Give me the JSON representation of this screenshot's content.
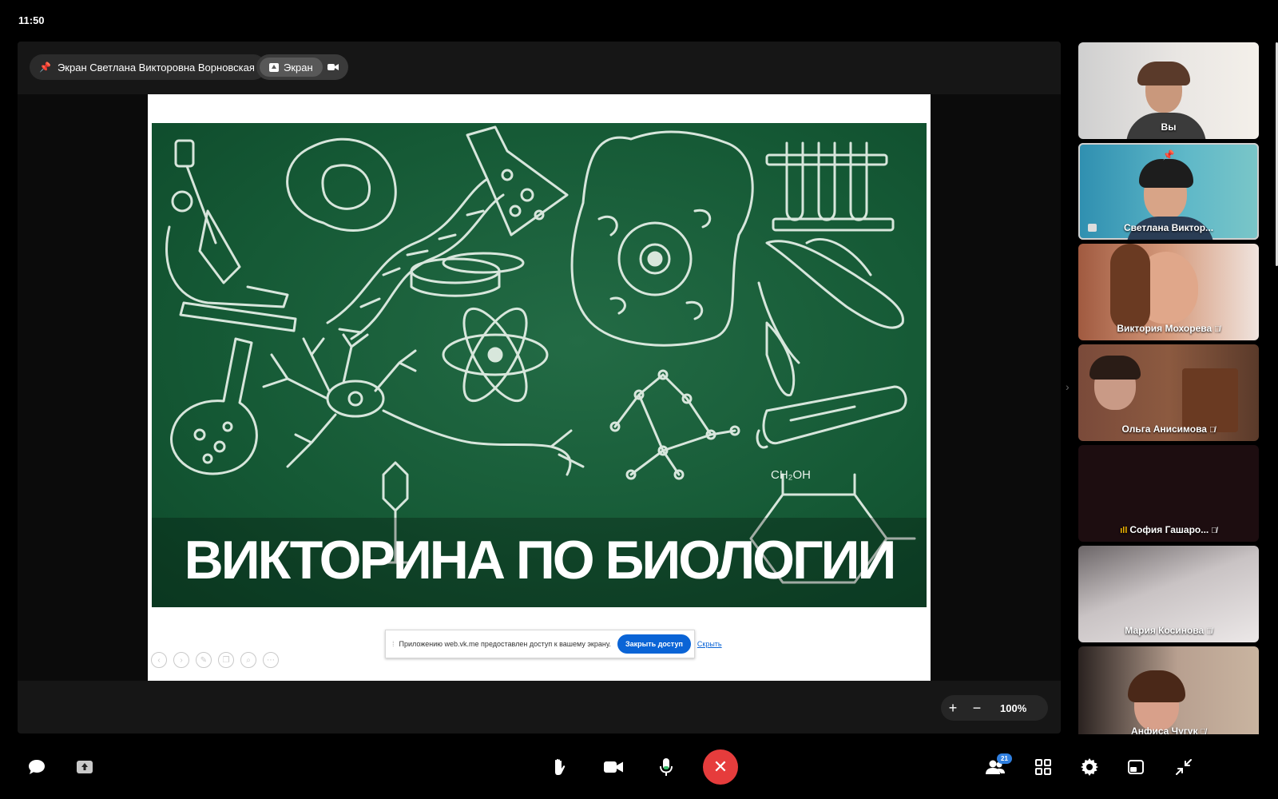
{
  "clock": "11:50",
  "stage": {
    "pinned_label": "Экран Светлана Викторовна Ворновская",
    "screen_label": "Экран",
    "zoom_value": "100%"
  },
  "slide": {
    "title": "ВИКТОРИНА ПО БИОЛОГИИ",
    "chem_label": "CH₂OH",
    "notice_text": "Приложению web.vk.me предоставлен доступ к вашему экрану.",
    "notice_button": "Закрыть доступ",
    "notice_hide": "Скрыть"
  },
  "participants": [
    {
      "name": "Вы",
      "muted": false
    },
    {
      "name": "Светлана Виктор...",
      "muted": false,
      "pinned": true,
      "sharing": true
    },
    {
      "name": "Виктория Мохорева",
      "muted": true
    },
    {
      "name": "Ольга Анисимова",
      "muted": true
    },
    {
      "name": "София Гашаро...",
      "muted": true,
      "speaking": true
    },
    {
      "name": "Мария Косинова",
      "muted": true
    },
    {
      "name": "Анфиса Чугук",
      "muted": true
    }
  ],
  "toolbar": {
    "participants_count": "21"
  },
  "icons": [
    "chat-icon",
    "share-screen-icon",
    "raise-hand-icon",
    "camera-icon",
    "microphone-icon",
    "end-call-icon",
    "participants-icon",
    "grid-icon",
    "settings-icon",
    "layout-icon",
    "collapse-icon"
  ],
  "colors": {
    "end_call": "#e63c3c",
    "accent_blue": "#0a64d6",
    "board_green": "#155935",
    "badge": "#2f7fe0"
  }
}
